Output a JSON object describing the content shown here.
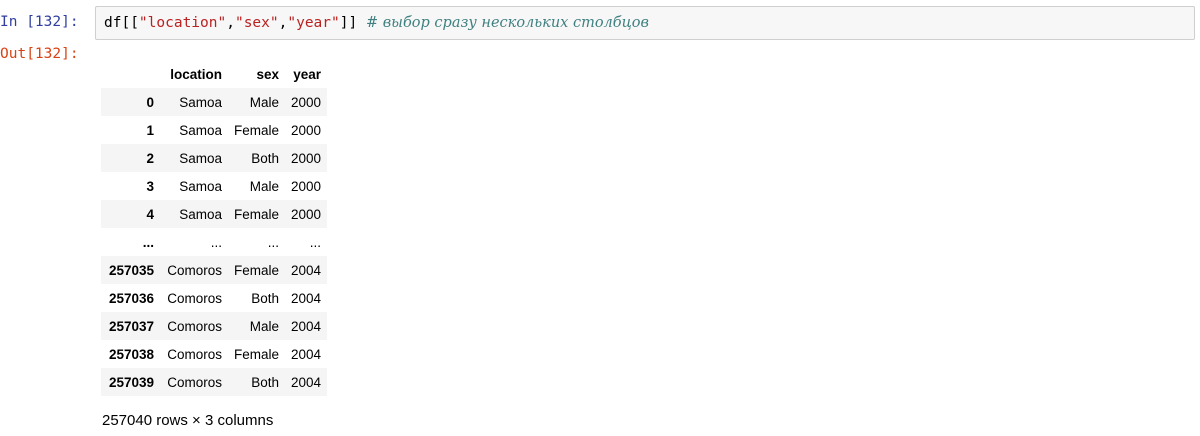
{
  "cell": {
    "in_prompt": "In [132]:",
    "out_prompt": "Out[132]:",
    "code": {
      "part1": "df[[",
      "str1": "\"location\"",
      "sep1": ",",
      "str2": "\"sex\"",
      "sep2": ",",
      "str3": "\"year\"",
      "part2": "]] ",
      "comment": "# выбор сразу нескольких столбцов"
    }
  },
  "table": {
    "columns": [
      "location",
      "sex",
      "year"
    ],
    "rows": [
      {
        "index": "0",
        "location": "Samoa",
        "sex": "Male",
        "year": "2000"
      },
      {
        "index": "1",
        "location": "Samoa",
        "sex": "Female",
        "year": "2000"
      },
      {
        "index": "2",
        "location": "Samoa",
        "sex": "Both",
        "year": "2000"
      },
      {
        "index": "3",
        "location": "Samoa",
        "sex": "Male",
        "year": "2000"
      },
      {
        "index": "4",
        "location": "Samoa",
        "sex": "Female",
        "year": "2000"
      },
      {
        "index": "...",
        "location": "...",
        "sex": "...",
        "year": "..."
      },
      {
        "index": "257035",
        "location": "Comoros",
        "sex": "Female",
        "year": "2004"
      },
      {
        "index": "257036",
        "location": "Comoros",
        "sex": "Both",
        "year": "2004"
      },
      {
        "index": "257037",
        "location": "Comoros",
        "sex": "Male",
        "year": "2004"
      },
      {
        "index": "257038",
        "location": "Comoros",
        "sex": "Female",
        "year": "2004"
      },
      {
        "index": "257039",
        "location": "Comoros",
        "sex": "Both",
        "year": "2004"
      }
    ],
    "shape_text": "257040 rows × 3 columns"
  },
  "colors": {
    "in_prompt": "#303F9F",
    "out_prompt": "#D84315",
    "string": "#BA2121",
    "comment": "#408080",
    "stripe": "#f5f5f5"
  }
}
